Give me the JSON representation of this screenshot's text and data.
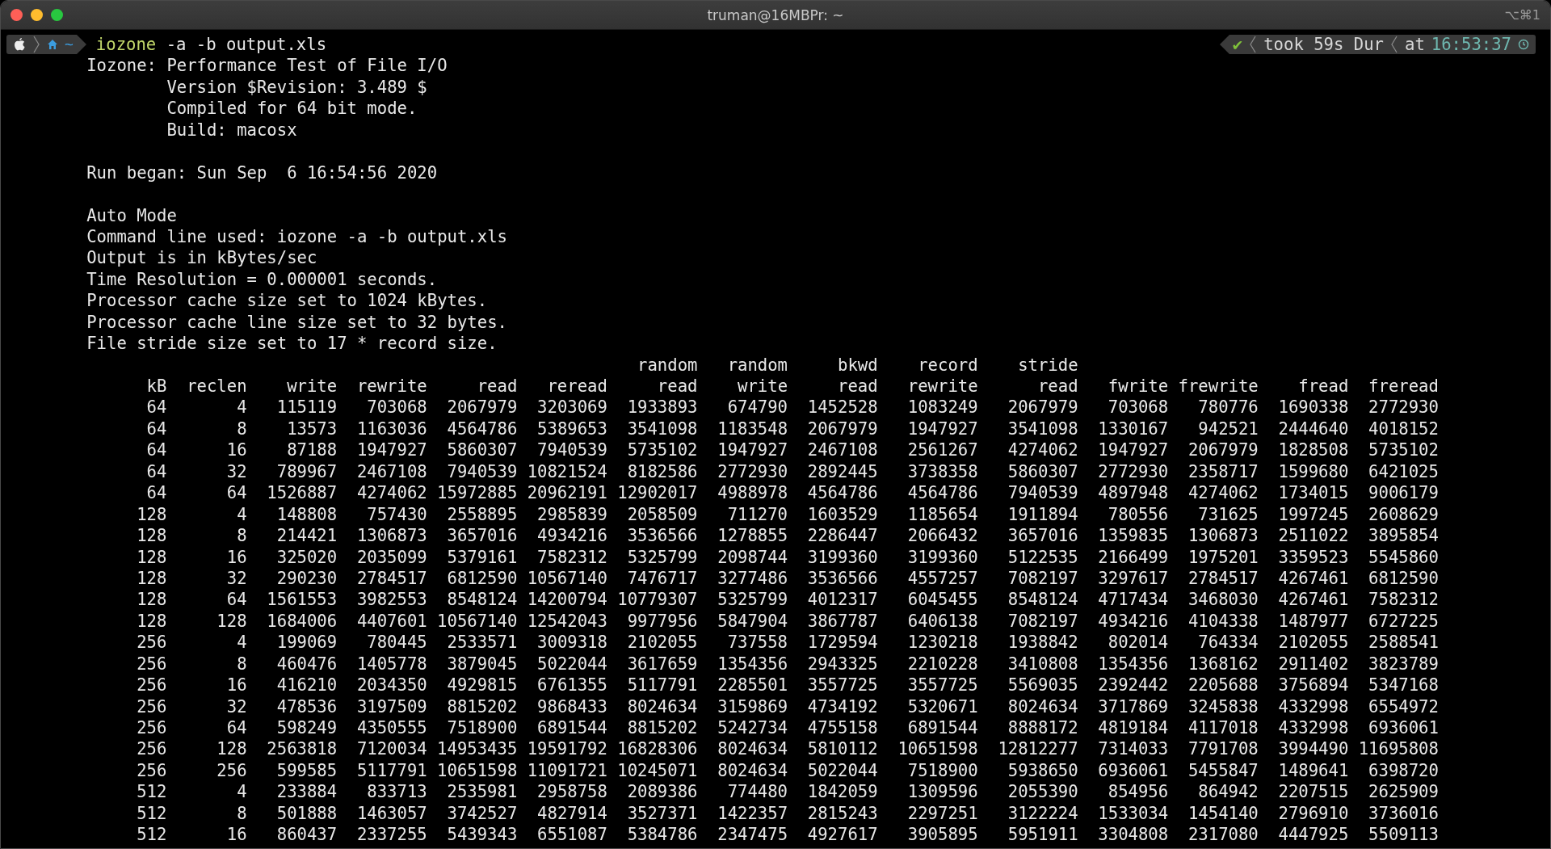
{
  "window": {
    "title": "truman@16MBPr: ~",
    "shortcut": "⌥⌘1"
  },
  "prompt": {
    "directory": "~",
    "command": {
      "program": "iozone",
      "args": "-a -b output.xls"
    },
    "status": "✔",
    "duration": "took 59s Dur",
    "at": "at",
    "time": "16:53:37"
  },
  "output_blocks": [
    {
      "lines": [
        {
          "kind": "main",
          "text": "Iozone: Performance Test of File I/O"
        },
        {
          "kind": "sub",
          "text": "Version $Revision: 3.489 $"
        },
        {
          "kind": "sub",
          "text": "Compiled for 64 bit mode."
        },
        {
          "kind": "sub",
          "text": "Build: macosx"
        }
      ]
    },
    {
      "lines": [
        {
          "kind": "main",
          "text": "Run began: Sun Sep  6 16:54:56 2020"
        }
      ]
    },
    {
      "lines": [
        {
          "kind": "main",
          "text": "Auto Mode"
        },
        {
          "kind": "main",
          "text": "Command line used: iozone -a -b output.xls"
        },
        {
          "kind": "main",
          "text": "Output is in kBytes/sec"
        },
        {
          "kind": "main",
          "text": "Time Resolution = 0.000001 seconds."
        },
        {
          "kind": "main",
          "text": "Processor cache size set to 1024 kBytes."
        },
        {
          "kind": "main",
          "text": "Processor cache line size set to 32 bytes."
        },
        {
          "kind": "main",
          "text": "File stride size set to 17 * record size."
        }
      ]
    }
  ],
  "table": {
    "columns": [
      {
        "label": "kB"
      },
      {
        "label": "reclen"
      },
      {
        "label": "write"
      },
      {
        "label": "rewrite"
      },
      {
        "label": "read"
      },
      {
        "label": "reread"
      },
      {
        "top": "random",
        "label": "read"
      },
      {
        "top": "random",
        "label": "write"
      },
      {
        "top": "bkwd",
        "label": "read"
      },
      {
        "top": "record",
        "label": "rewrite"
      },
      {
        "top": "stride",
        "label": "read"
      },
      {
        "label": "fwrite"
      },
      {
        "label": "frewrite"
      },
      {
        "label": "fread"
      },
      {
        "label": "freread"
      }
    ],
    "rows": [
      [
        "64",
        "4",
        "115119",
        "703068",
        "2067979",
        "3203069",
        "1933893",
        "674790",
        "1452528",
        "1083249",
        "2067979",
        "703068",
        "780776",
        "1690338",
        "2772930"
      ],
      [
        "64",
        "8",
        "13573",
        "1163036",
        "4564786",
        "5389653",
        "3541098",
        "1183548",
        "2067979",
        "1947927",
        "3541098",
        "1330167",
        "942521",
        "2444640",
        "4018152"
      ],
      [
        "64",
        "16",
        "87188",
        "1947927",
        "5860307",
        "7940539",
        "5735102",
        "1947927",
        "2467108",
        "2561267",
        "4274062",
        "1947927",
        "2067979",
        "1828508",
        "5735102"
      ],
      [
        "64",
        "32",
        "789967",
        "2467108",
        "7940539",
        "10821524",
        "8182586",
        "2772930",
        "2892445",
        "3738358",
        "5860307",
        "2772930",
        "2358717",
        "1599680",
        "6421025"
      ],
      [
        "64",
        "64",
        "1526887",
        "4274062",
        "15972885",
        "20962191",
        "12902017",
        "4988978",
        "4564786",
        "4564786",
        "7940539",
        "4897948",
        "4274062",
        "1734015",
        "9006179"
      ],
      [
        "128",
        "4",
        "148808",
        "757430",
        "2558895",
        "2985839",
        "2058509",
        "711270",
        "1603529",
        "1185654",
        "1911894",
        "780556",
        "731625",
        "1997245",
        "2608629"
      ],
      [
        "128",
        "8",
        "214421",
        "1306873",
        "3657016",
        "4934216",
        "3536566",
        "1278855",
        "2286447",
        "2066432",
        "3657016",
        "1359835",
        "1306873",
        "2511022",
        "3895854"
      ],
      [
        "128",
        "16",
        "325020",
        "2035099",
        "5379161",
        "7582312",
        "5325799",
        "2098744",
        "3199360",
        "3199360",
        "5122535",
        "2166499",
        "1975201",
        "3359523",
        "5545860"
      ],
      [
        "128",
        "32",
        "290230",
        "2784517",
        "6812590",
        "10567140",
        "7476717",
        "3277486",
        "3536566",
        "4557257",
        "7082197",
        "3297617",
        "2784517",
        "4267461",
        "6812590"
      ],
      [
        "128",
        "64",
        "1561553",
        "3982553",
        "8548124",
        "14200794",
        "10779307",
        "5325799",
        "4012317",
        "6045455",
        "8548124",
        "4717434",
        "3468030",
        "4267461",
        "7582312"
      ],
      [
        "128",
        "128",
        "1684006",
        "4407601",
        "10567140",
        "12542043",
        "9977956",
        "5847904",
        "3867787",
        "6406138",
        "7082197",
        "4934216",
        "4104338",
        "1487977",
        "6727225"
      ],
      [
        "256",
        "4",
        "199069",
        "780445",
        "2533571",
        "3009318",
        "2102055",
        "737558",
        "1729594",
        "1230218",
        "1938842",
        "802014",
        "764334",
        "2102055",
        "2588541"
      ],
      [
        "256",
        "8",
        "460476",
        "1405778",
        "3879045",
        "5022044",
        "3617659",
        "1354356",
        "2943325",
        "2210228",
        "3410808",
        "1354356",
        "1368162",
        "2911402",
        "3823789"
      ],
      [
        "256",
        "16",
        "416210",
        "2034350",
        "4929815",
        "6761355",
        "5117791",
        "2285501",
        "3557725",
        "3557725",
        "5569035",
        "2392442",
        "2205688",
        "3756894",
        "5347168"
      ],
      [
        "256",
        "32",
        "478536",
        "3197509",
        "8815202",
        "9868433",
        "8024634",
        "3159869",
        "4734192",
        "5320671",
        "8024634",
        "3717869",
        "3245838",
        "4332998",
        "6554972"
      ],
      [
        "256",
        "64",
        "598249",
        "4350555",
        "7518900",
        "6891544",
        "8815202",
        "5242734",
        "4755158",
        "6891544",
        "8888172",
        "4819184",
        "4117018",
        "4332998",
        "6936061"
      ],
      [
        "256",
        "128",
        "2563818",
        "7120034",
        "14953435",
        "19591792",
        "16828306",
        "8024634",
        "5810112",
        "10651598",
        "12812277",
        "7314033",
        "7791708",
        "3994490",
        "11695808"
      ],
      [
        "256",
        "256",
        "599585",
        "5117791",
        "10651598",
        "11091721",
        "10245071",
        "8024634",
        "5022044",
        "7518900",
        "5938650",
        "6936061",
        "5455847",
        "1489641",
        "6398720"
      ],
      [
        "512",
        "4",
        "233884",
        "833713",
        "2535981",
        "2958758",
        "2089386",
        "774480",
        "1842059",
        "1309596",
        "2055390",
        "854956",
        "864942",
        "2207515",
        "2625909"
      ],
      [
        "512",
        "8",
        "501888",
        "1463057",
        "3742527",
        "4827914",
        "3527371",
        "1422357",
        "2815243",
        "2297251",
        "3122224",
        "1533034",
        "1454140",
        "2796910",
        "3736016"
      ],
      [
        "512",
        "16",
        "860437",
        "2337255",
        "5439343",
        "6551087",
        "5384786",
        "2347475",
        "4927617",
        "3905895",
        "5951911",
        "3304808",
        "2317080",
        "4447925",
        "5509113"
      ]
    ]
  }
}
